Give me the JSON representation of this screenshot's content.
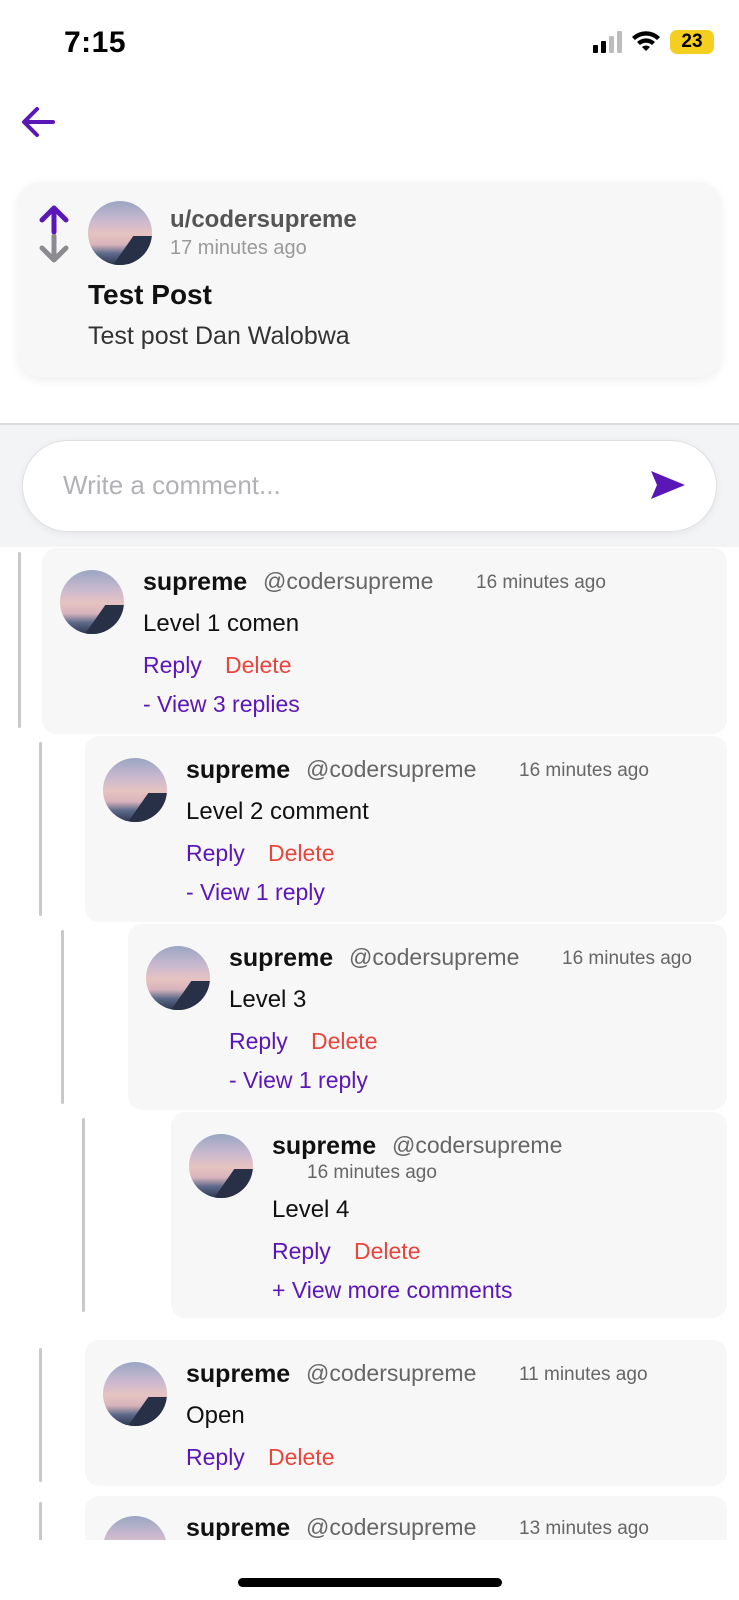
{
  "status_bar": {
    "time": "7:15",
    "battery": "23"
  },
  "post": {
    "username": "u/codersupreme",
    "time": "17 minutes ago",
    "title": "Test Post",
    "body": "Test post Dan Walobwa"
  },
  "comment_input": {
    "placeholder": "Write a comment..."
  },
  "comments": [
    {
      "name": "supreme",
      "handle": "@codersupreme",
      "time": "16 minutes ago",
      "text": "Level 1 comen",
      "reply": "Reply",
      "delete": "Delete",
      "more": "- View 3 replies"
    },
    {
      "name": "supreme",
      "handle": "@codersupreme",
      "time": "16 minutes ago",
      "text": "Level 2 comment",
      "reply": "Reply",
      "delete": "Delete",
      "more": "- View 1 reply"
    },
    {
      "name": "supreme",
      "handle": "@codersupreme",
      "time": "16 minutes ago",
      "text": "Level 3",
      "reply": "Reply",
      "delete": "Delete",
      "more": "- View 1 reply"
    },
    {
      "name": "supreme",
      "handle": "@codersupreme",
      "time": "16 minutes ago",
      "text": "Level 4",
      "reply": "Reply",
      "delete": "Delete",
      "more": "+ View more comments"
    },
    {
      "name": "supreme",
      "handle": "@codersupreme",
      "time": "11 minutes ago",
      "text": "Open",
      "reply": "Reply",
      "delete": "Delete"
    },
    {
      "name": "supreme",
      "handle": "@codersupreme",
      "time": "13 minutes ago"
    }
  ],
  "colors": {
    "accent": "#5b16b8",
    "delete": "#e8453c",
    "card": "#f7f7f8"
  }
}
